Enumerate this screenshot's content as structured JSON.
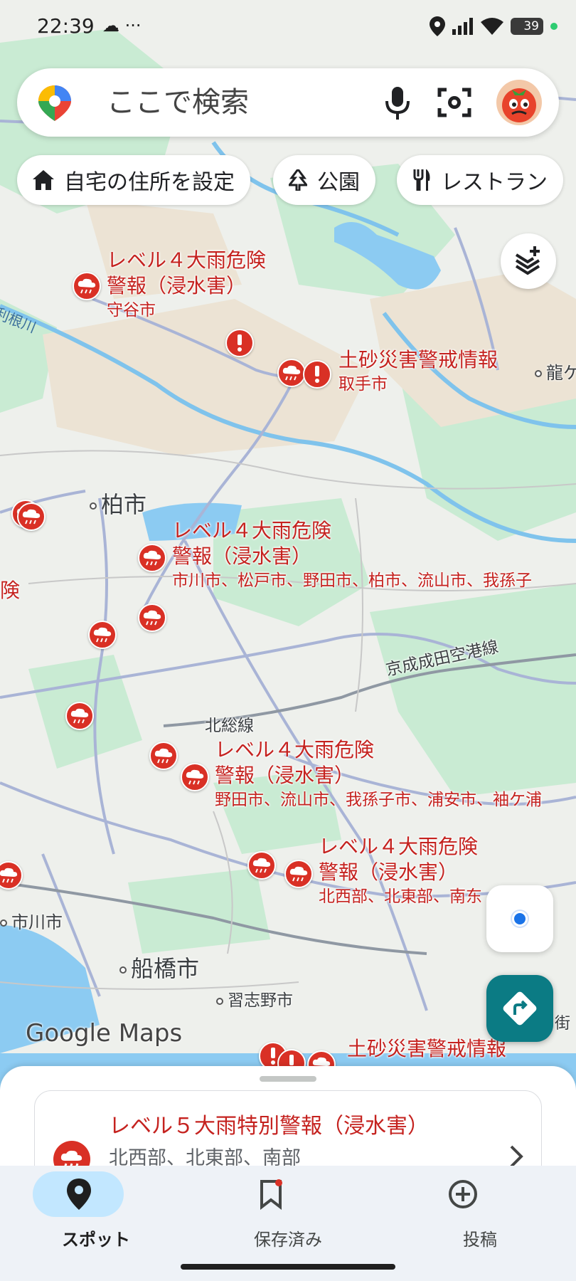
{
  "status_bar": {
    "time": "22:39",
    "extra": "☁ ···",
    "battery": "39"
  },
  "search": {
    "placeholder": "ここで検索"
  },
  "chips": [
    {
      "label": "自宅の住所を設定",
      "icon": "home-icon"
    },
    {
      "label": "公園",
      "icon": "tree-icon"
    },
    {
      "label": "レストラン",
      "icon": "restaurant-icon"
    }
  ],
  "alerts": [
    {
      "title_line1": "レベル４大雨危険",
      "title_line2": "警報（浸水害）",
      "area": "守谷市"
    },
    {
      "title_line1": "土砂災害警戒情報",
      "area": "取手市"
    },
    {
      "title_line1": "レベル４大雨危険",
      "title_line2": "警報（浸水害）",
      "area": "市川市、松戸市、野田市、柏市、流山市、我孫子"
    },
    {
      "title_line1": "レベル４大雨危険",
      "title_line2": "警報（浸水害）",
      "area": "野田市、流山市、我孫子市、浦安市、袖ケ浦"
    },
    {
      "title_line1": "レベル４大雨危険",
      "title_line2": "警報（浸水害）",
      "area": "北西部、北東部、南东"
    },
    {
      "title_line1": "土砂災害警戒情報"
    },
    {
      "title_line1": "険"
    }
  ],
  "places": {
    "kashiwa": "柏市",
    "funabashi": "船橋市",
    "ichikawa": "市川市",
    "narashino": "習志野市",
    "ryugasaki": "龍ケ",
    "edge_right": "街"
  },
  "lines": {
    "keisei": "京成成田空港線",
    "hokuso": "北総線"
  },
  "rivers": {
    "tone": "利根川"
  },
  "map_brand": "Google Maps",
  "bottom_sheet": {
    "title": "レベル５大雨特別警報（浸水害）",
    "subtitle": "北西部、北東部、南部"
  },
  "nav": [
    {
      "label": "スポット",
      "icon": "pin-icon",
      "active": true
    },
    {
      "label": "保存済み",
      "icon": "bookmark-icon",
      "active": false
    },
    {
      "label": "投稿",
      "icon": "add-circle-icon",
      "active": false
    }
  ],
  "colors": {
    "alert_red": "#d93025",
    "accent_teal": "#0b7b84",
    "location_blue": "#1a73e8"
  }
}
